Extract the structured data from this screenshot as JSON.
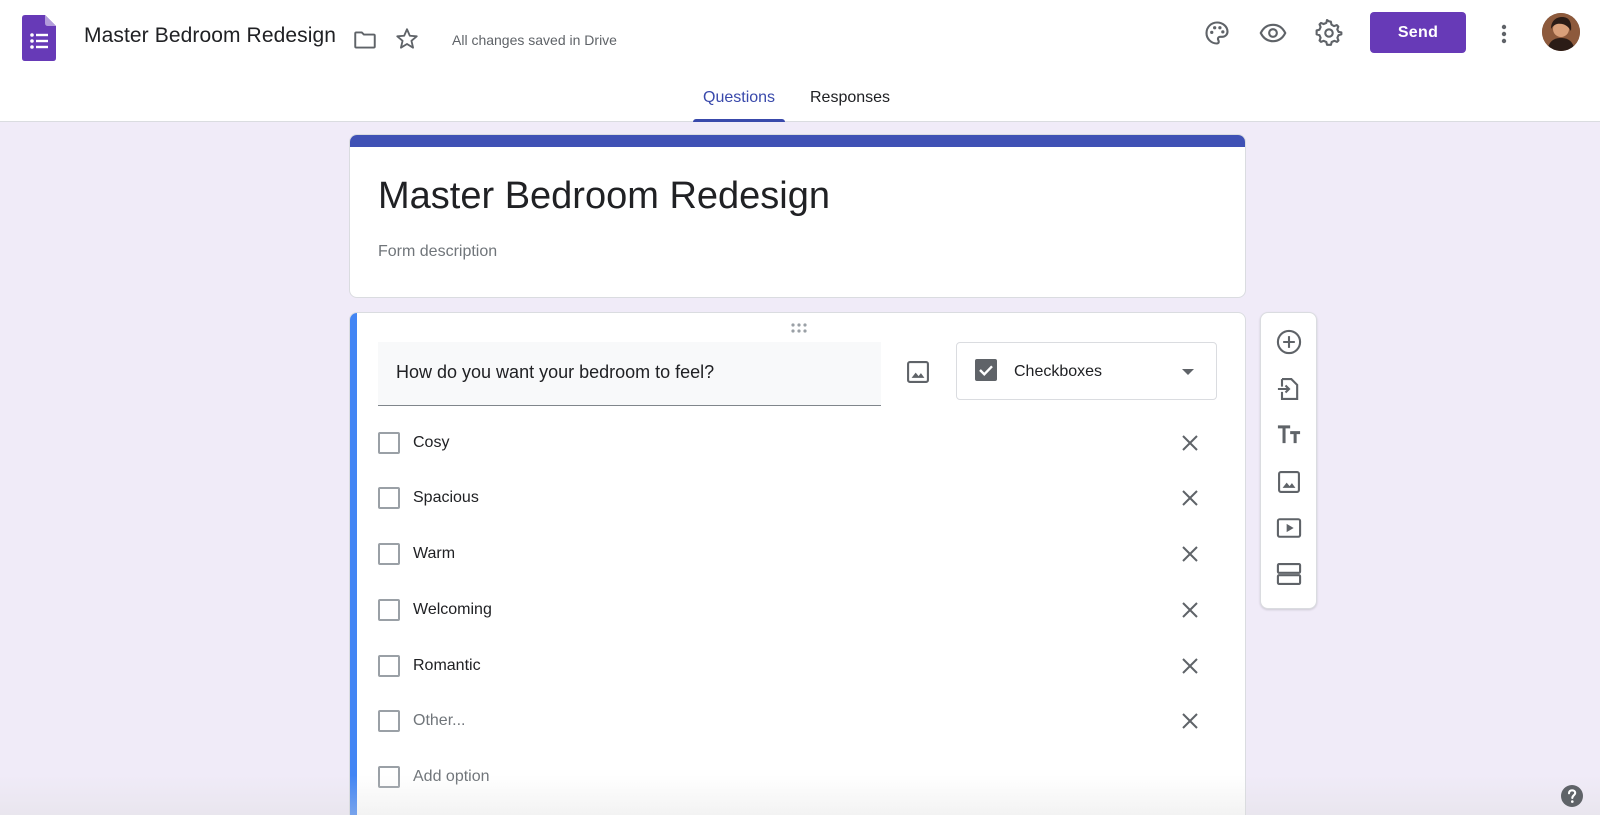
{
  "header": {
    "doc_title": "Master Bedroom Redesign",
    "save_status": "All changes saved in Drive",
    "send_label": "Send",
    "icons": [
      "forms-logo-icon",
      "folder-icon",
      "star-icon",
      "palette-icon",
      "preview-icon",
      "settings-icon",
      "more-vert-icon"
    ]
  },
  "tabs": [
    {
      "label": "Questions",
      "active": true
    },
    {
      "label": "Responses",
      "active": false
    }
  ],
  "form": {
    "title": "Master Bedroom Redesign",
    "description_placeholder": "Form description"
  },
  "question": {
    "title": "How do you want your bedroom to feel?",
    "type": "Checkboxes",
    "options": [
      {
        "label": "Cosy"
      },
      {
        "label": "Spacious"
      },
      {
        "label": "Warm"
      },
      {
        "label": "Welcoming"
      },
      {
        "label": "Romantic"
      },
      {
        "label": "Other..."
      }
    ],
    "add_option_label": "Add option"
  },
  "side_toolbar": [
    "add-question-icon",
    "import-questions-icon",
    "add-title-icon",
    "add-image-icon",
    "add-video-icon",
    "add-section-icon"
  ],
  "colors": {
    "brand": "#673ab7",
    "header_band": "#3f51b5",
    "active_tab": "#3949ab",
    "focus_bar": "#4285f4",
    "background": "#f0ebf8"
  }
}
